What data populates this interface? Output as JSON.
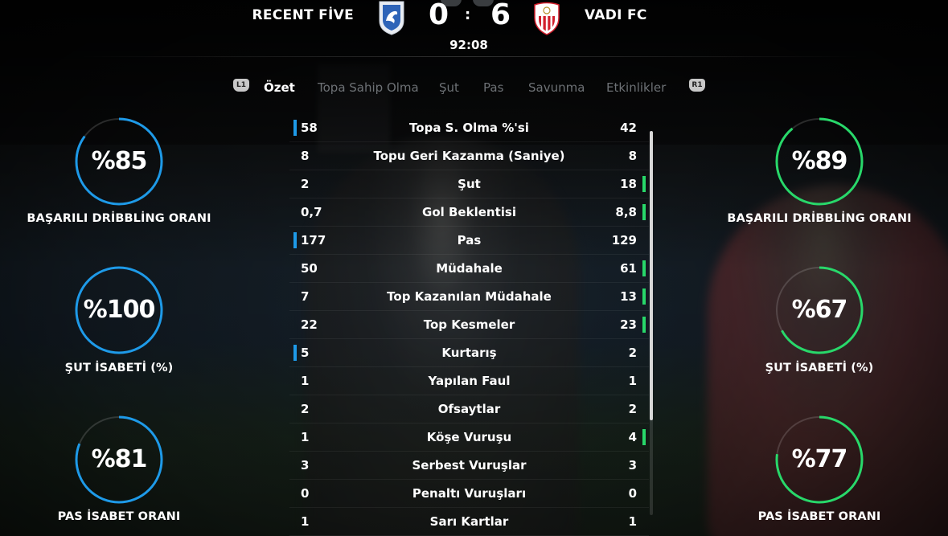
{
  "colors": {
    "home_accent": "#1e9ae8",
    "away_accent": "#28d86a"
  },
  "match": {
    "home_team": "RECENT FİVE",
    "away_team": "VADI FC",
    "home_score": "0",
    "away_score": "6",
    "separator": ":",
    "clock": "92:08",
    "home_crest": "dolphin-crest-icon",
    "away_crest": "sevilla-crest-icon"
  },
  "tabs": {
    "left_button": "L1",
    "right_button": "R1",
    "items": [
      "Özet",
      "Topa Sahip Olma",
      "Şut",
      "Pas",
      "Savunma",
      "Etkinlikler"
    ],
    "active_index": 0
  },
  "home_gauges": [
    {
      "value": "%85",
      "percent": 85,
      "label": "BAŞARILI DRİBBLİNG ORANI"
    },
    {
      "value": "%100",
      "percent": 100,
      "label": "ŞUT İSABETİ (%)"
    },
    {
      "value": "%81",
      "percent": 81,
      "label": "PAS İSABET ORANI"
    }
  ],
  "away_gauges": [
    {
      "value": "%89",
      "percent": 89,
      "label": "BAŞARILI DRİBBLİNG ORANI"
    },
    {
      "value": "%67",
      "percent": 67,
      "label": "ŞUT İSABETİ (%)"
    },
    {
      "value": "%77",
      "percent": 77,
      "label": "PAS İSABET ORANI"
    }
  ],
  "stats": [
    {
      "home": "58",
      "name": "Topa S. Olma %'si",
      "away": "42",
      "leader": "home"
    },
    {
      "home": "8",
      "name": "Topu Geri Kazanma (Saniye)",
      "away": "8",
      "leader": "none"
    },
    {
      "home": "2",
      "name": "Şut",
      "away": "18",
      "leader": "away"
    },
    {
      "home": "0,7",
      "name": "Gol Beklentisi",
      "away": "8,8",
      "leader": "away"
    },
    {
      "home": "177",
      "name": "Pas",
      "away": "129",
      "leader": "home"
    },
    {
      "home": "50",
      "name": "Müdahale",
      "away": "61",
      "leader": "away"
    },
    {
      "home": "7",
      "name": "Top Kazanılan Müdahale",
      "away": "13",
      "leader": "away"
    },
    {
      "home": "22",
      "name": "Top Kesmeler",
      "away": "23",
      "leader": "away"
    },
    {
      "home": "5",
      "name": "Kurtarış",
      "away": "2",
      "leader": "home"
    },
    {
      "home": "1",
      "name": "Yapılan Faul",
      "away": "1",
      "leader": "none"
    },
    {
      "home": "2",
      "name": "Ofsaytlar",
      "away": "2",
      "leader": "none"
    },
    {
      "home": "1",
      "name": "Köşe Vuruşu",
      "away": "4",
      "leader": "away"
    },
    {
      "home": "3",
      "name": "Serbest Vuruşlar",
      "away": "3",
      "leader": "none"
    },
    {
      "home": "0",
      "name": "Penaltı Vuruşları",
      "away": "0",
      "leader": "none"
    },
    {
      "home": "1",
      "name": "Sarı Kartlar",
      "away": "1",
      "leader": "none"
    }
  ]
}
